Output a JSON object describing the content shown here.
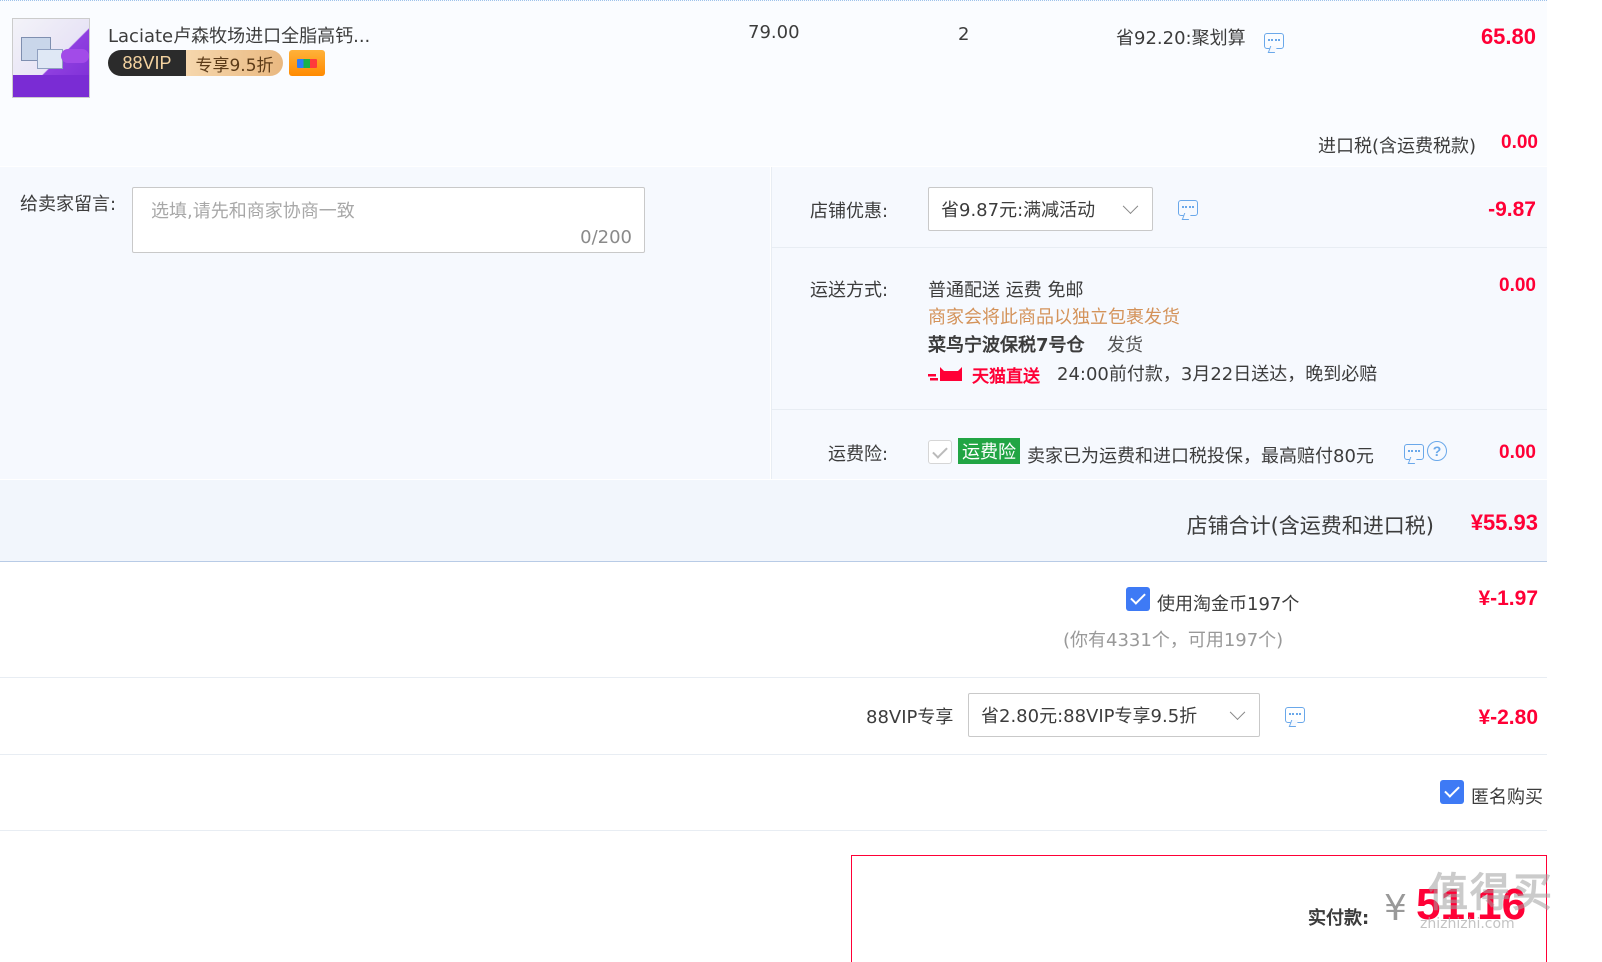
{
  "product": {
    "title": "Laciate卢森牧场进口全脂高钙...",
    "vip_tag_left": "88VIP",
    "vip_tag_right": "专享9.5折",
    "unit_price": "79.00",
    "quantity": "2",
    "discount": "省92.20:聚划算",
    "subtotal": "65.80",
    "import_tax_label": "进口税(含运费税款)",
    "import_tax_value": "0.00"
  },
  "message": {
    "label": "给卖家留言:",
    "placeholder": "选填,请先和商家协商一致",
    "counter": "0/200"
  },
  "store_discount": {
    "label": "店铺优惠:",
    "selected": "省9.87元:满减活动",
    "amount": "-9.87"
  },
  "shipping": {
    "label": "运送方式:",
    "method": "普通配送 运费 免邮",
    "note": "商家会将此商品以独立包裹发货",
    "warehouse": "菜鸟宁波保税7号仓",
    "warehouse_suffix": "发货",
    "tmall_tag": "天猫直送",
    "delivery_promise": "24:00前付款，3月22日送达，晚到必赔",
    "amount": "0.00"
  },
  "insurance": {
    "label": "运费险:",
    "tag": "运费险",
    "text": "卖家已为运费和进口税投保，最高赔付80元",
    "amount": "0.00"
  },
  "store_total": {
    "label": "店铺合计(含运费和进口税)",
    "amount": "¥55.93"
  },
  "coins": {
    "label": "使用淘金币197个",
    "hint": "(你有4331个，可用197个)",
    "amount": "¥-1.97"
  },
  "vip": {
    "label": "88VIP专享",
    "selected": "省2.80元:88VIP专享9.5折",
    "amount": "¥-2.80"
  },
  "anonymous": {
    "label": "匿名购买"
  },
  "payment": {
    "label": "实付款:",
    "currency": "¥",
    "amount": "51.16"
  },
  "watermark": {
    "text": "值得买",
    "site": "zhizhizhi.com"
  },
  "colors": {
    "price_red": "#ff0036",
    "link_blue": "#6aa8ea",
    "insurance_green": "#22a544",
    "checkbox_blue": "#3e7af5",
    "shipping_note_orange": "#d4935a"
  }
}
